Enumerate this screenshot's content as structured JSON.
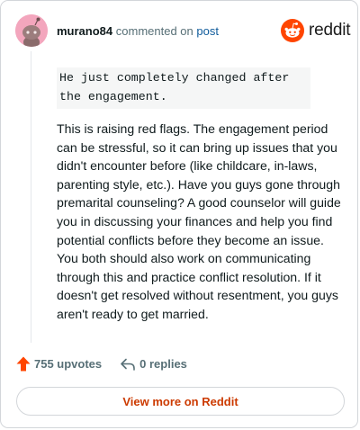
{
  "header": {
    "username": "murano84",
    "commented_text": "commented on",
    "post_link": "post"
  },
  "logo": {
    "text": "reddit",
    "brand_color": "#ff4500"
  },
  "comment": {
    "quote": "He just completely changed after the engagement.",
    "body": "This is raising red flags. The engagement period can be stressful, so it can bring up issues that you didn't encounter before (like childcare, in-laws, parenting style, etc.). Have you guys gone through premarital counseling? A good counselor will guide you in discussing your finances and help you find potential conflicts before they become an issue. You both should also work on communicating through this and practice conflict resolution. If it doesn't get resolved without resentment, you guys aren't ready to get married."
  },
  "footer": {
    "upvotes": "755 upvotes",
    "replies": "0 replies",
    "view_more": "View more on Reddit"
  },
  "colors": {
    "accent": "#ff4500",
    "link": "#0f5b9b",
    "view_more_text": "#cc3a00",
    "avatar_bg": "#f3a6bd"
  }
}
